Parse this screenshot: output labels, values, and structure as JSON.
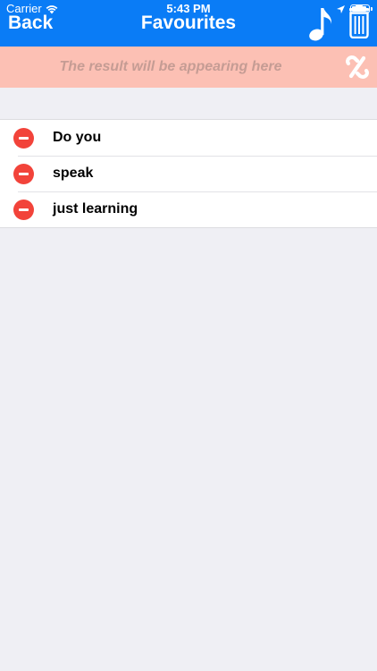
{
  "status_bar": {
    "carrier": "Carrier",
    "time": "5:43 PM",
    "wifi_icon": "wifi-icon",
    "location_icon": "location-arrow-icon",
    "battery_icon": "battery-icon"
  },
  "nav": {
    "back_label": "Back",
    "title": "Favourites",
    "music_icon": "music-note-icon",
    "trash_icon": "trash-icon"
  },
  "result": {
    "placeholder": "The result will be appearing here",
    "icon": "translate-icon"
  },
  "favourites": [
    {
      "text": "Do you"
    },
    {
      "text": "speak"
    },
    {
      "text": "just learning"
    }
  ],
  "colors": {
    "nav_bg": "#0a7cf6",
    "banner_bg": "#fcc0b4",
    "banner_text": "#c59c94",
    "delete": "#f2433a",
    "background": "#efeff4"
  }
}
